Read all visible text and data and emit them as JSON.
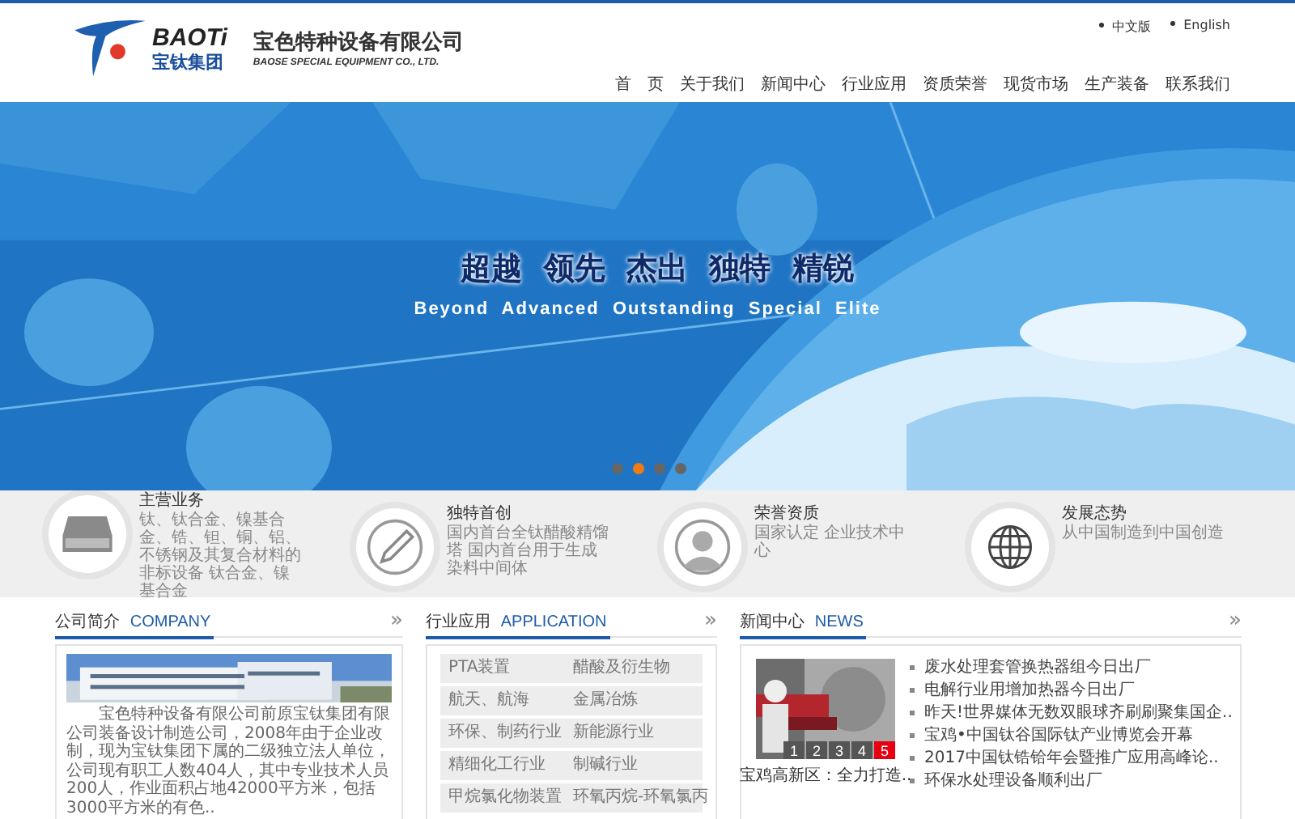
{
  "header": {
    "logo_brand": "BAOTi",
    "logo_group": "宝钛集团",
    "company_name": "宝色特种设备有限公司",
    "company_name_en": "BAOSE SPECIAL EQUIPMENT CO., LTD.",
    "languages": [
      "中文版",
      "English"
    ],
    "nav": [
      {
        "label": "首　页"
      },
      {
        "label": "关于我们"
      },
      {
        "label": "新闻中心"
      },
      {
        "label": "行业应用"
      },
      {
        "label": "资质荣誉"
      },
      {
        "label": "现货市场"
      },
      {
        "label": "生产装备"
      },
      {
        "label": "联系我们"
      }
    ]
  },
  "banner": {
    "slogan": "超越  领先  杰出  独特  精锐",
    "slogan_en": "Beyond  Advanced  Outstanding  Special  Elite",
    "dots": [
      {
        "selected": false
      },
      {
        "selected": true
      },
      {
        "selected": false
      },
      {
        "selected": false
      }
    ]
  },
  "features": [
    {
      "kind": "drive",
      "title": "主营业务",
      "text": "钛、钛合金、镍基合金、锆、钽、铜、铝、不锈钢及其复合材料的非标设备 钛合金、镍基合金"
    },
    {
      "kind": "pen",
      "title": "独特首创",
      "text": "国内首台全钛醋酸精馏塔 国内首台用于生成染料中间体"
    },
    {
      "kind": "person",
      "title": "荣誉资质",
      "text": "国家认定 企业技术中心"
    },
    {
      "kind": "globe",
      "title": "发展态势",
      "text": "从中国制造到中国创造"
    }
  ],
  "company": {
    "title": "公司简介",
    "title_en": "COMPANY",
    "more": "»",
    "text": "宝色特种设备有限公司前原宝钛集团有限公司装备设计制造公司，2008年由于企业改制，现为宝钛集团下属的二级独立法人单位，公司现有职工人数404人，其中专业技术人员200人，作业面积占地42000平方米，包括3000平方米的有色.."
  },
  "application": {
    "title": "行业应用",
    "title_en": "APPLICATION",
    "more": "»",
    "rows": [
      [
        "PTA装置",
        "醋酸及衍生物"
      ],
      [
        "航天、航海",
        "金属冶炼"
      ],
      [
        "环保、制药行业",
        "新能源行业"
      ],
      [
        "精细化工行业",
        "制碱行业"
      ],
      [
        "甲烷氯化物装置",
        "环氧丙烷-环氧氯丙"
      ]
    ]
  },
  "news": {
    "title": "新闻中心",
    "title_en": "NEWS",
    "more": "»",
    "photo_caption": "宝鸡高新区：全力打造..",
    "pager": [
      {
        "label": "1",
        "selected": false
      },
      {
        "label": "2",
        "selected": false
      },
      {
        "label": "3",
        "selected": false
      },
      {
        "label": "4",
        "selected": false
      },
      {
        "label": "5",
        "selected": true
      }
    ],
    "items": [
      "废水处理套管换热器组今日出厂",
      "电解行业用增加热器今日出厂",
      "昨天!世界媒体无数双眼球齐刷刷聚集国企..",
      "宝鸡•中国钛谷国际钛产业博览会开幕",
      "2017中国钛锆铪年会暨推广应用高峰论..",
      "环保水处理设备顺利出厂"
    ]
  }
}
